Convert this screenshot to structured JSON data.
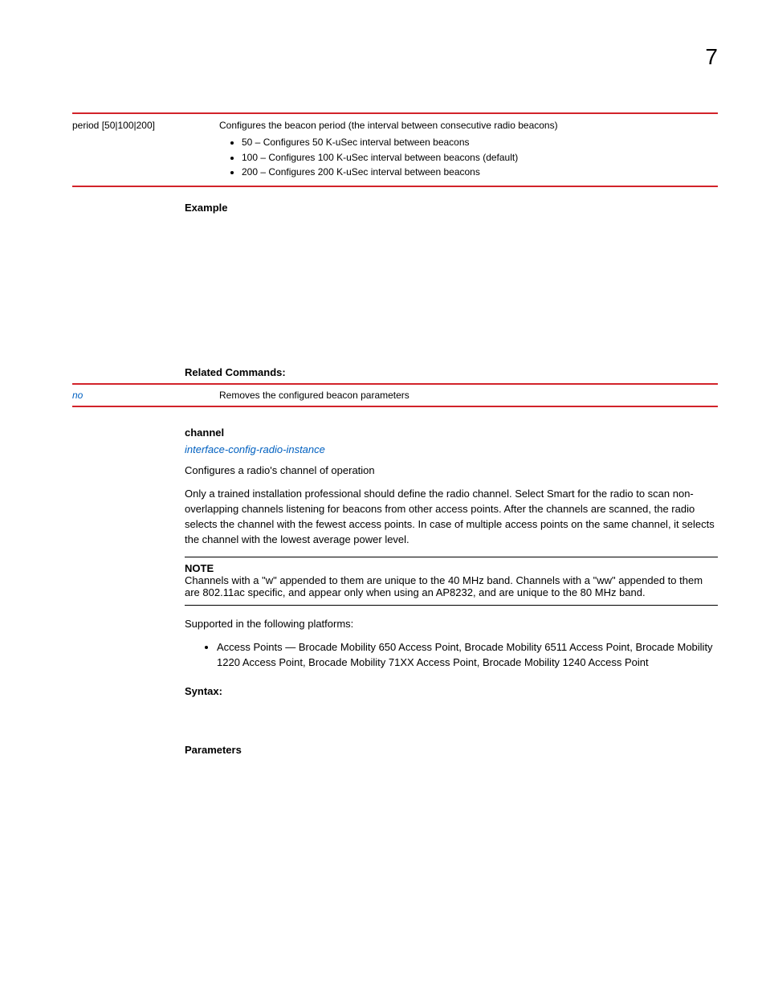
{
  "page_number": "7",
  "param_table": {
    "col1": "period [50|100|200]",
    "intro": "Configures the beacon period (the interval between consecutive radio beacons)",
    "bullets": [
      "50 – Configures 50 K-uSec interval between beacons",
      "100 – Configures 100 K-uSec interval between beacons (default)",
      "200 – Configures 200 K-uSec interval between beacons"
    ]
  },
  "example_label": "Example",
  "related": {
    "heading": "Related Commands:",
    "col1": "no",
    "col2": "Removes the configured beacon parameters"
  },
  "channel": {
    "heading": "channel",
    "link": "interface-config-radio-instance",
    "p1": "Configures a radio's channel of operation",
    "p2": "Only a trained installation professional should define the radio channel. Select Smart for the radio to scan non-overlapping channels listening for beacons from other access points. After the channels are scanned, the radio selects the channel with the fewest access points. In case of multiple access points on the same channel, it selects the channel with the lowest average power level."
  },
  "note": {
    "label": "NOTE",
    "text": "Channels with a \"w\" appended to them are unique to the 40 MHz band. Channels with a \"ww\" appended to them are 802.11ac specific, and appear only when using an AP8232, and are unique to the 80 MHz band."
  },
  "supported_label": "Supported in the following platforms:",
  "supported_bullet": "Access Points — Brocade Mobility 650 Access Point, Brocade Mobility 6511 Access Point, Brocade Mobility 1220 Access Point, Brocade Mobility 71XX Access Point, Brocade Mobility 1240 Access Point",
  "syntax_label": "Syntax:",
  "parameters_label": "Parameters"
}
